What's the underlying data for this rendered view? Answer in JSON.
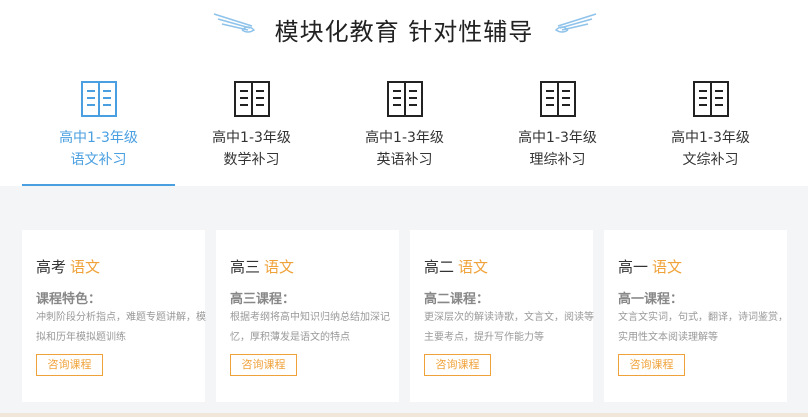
{
  "header": {
    "title": "模块化教育 针对性辅导"
  },
  "colors": {
    "accent_blue": "#4a9fe0",
    "accent_orange": "#f0a23a",
    "panel_bg": "#f4f5f7"
  },
  "tabs": [
    {
      "line1": "高中1-3年级",
      "line2": "语文补习",
      "active": true,
      "icon": "book-icon"
    },
    {
      "line1": "高中1-3年级",
      "line2": "数学补习",
      "active": false,
      "icon": "book-icon"
    },
    {
      "line1": "高中1-3年级",
      "line2": "英语补习",
      "active": false,
      "icon": "book-icon"
    },
    {
      "line1": "高中1-3年级",
      "line2": "理综补习",
      "active": false,
      "icon": "book-icon"
    },
    {
      "line1": "高中1-3年级",
      "line2": "文综补习",
      "active": false,
      "icon": "book-icon"
    }
  ],
  "cards": [
    {
      "grade": "高考",
      "subject": "语文",
      "label": "课程特色：",
      "desc": "冲刺阶段分析指点，难题专题讲解，模拟和历年模拟题训练",
      "button": "咨询课程"
    },
    {
      "grade": "高三",
      "subject": "语文",
      "label": "高三课程：",
      "desc": "根据考纲将高中知识归纳总结加深记忆，厚积薄发是语文的特点",
      "button": "咨询课程"
    },
    {
      "grade": "高二",
      "subject": "语文",
      "label": "高二课程：",
      "desc": "更深层次的解读诗歌，文言文，阅读等主要考点，提升写作能力等",
      "button": "咨询课程"
    },
    {
      "grade": "高一",
      "subject": "语文",
      "label": "高一课程：",
      "desc": "文言文实词，句式，翻译，诗词鉴赏，实用性文本阅读理解等",
      "button": "咨询课程"
    }
  ]
}
